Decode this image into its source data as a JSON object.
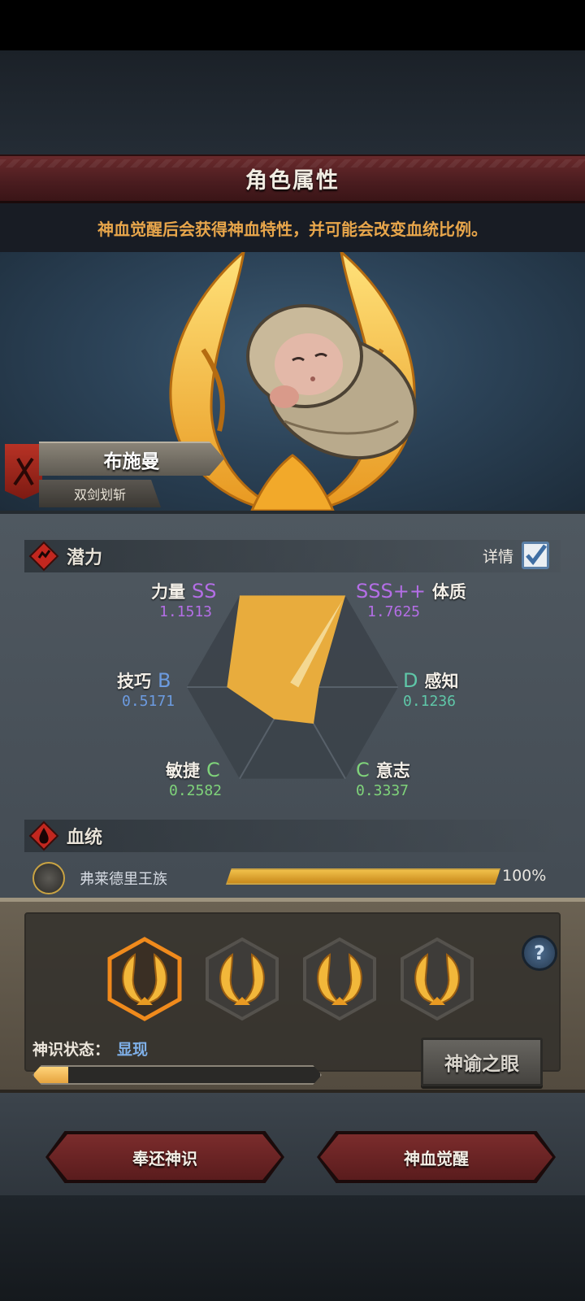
{
  "header": {
    "title": "角色属性",
    "subtitle": "神血觉醒后会获得神血特性，并可能会改变血统比例。"
  },
  "character": {
    "name": "布施曼",
    "class": "双剑划斩"
  },
  "potential": {
    "section_title": "潜力",
    "detail_label": "详情",
    "detail_checked": true,
    "stats": [
      {
        "name": "力量",
        "grade": "SS",
        "value": "1.1513",
        "color": "#b46ee6"
      },
      {
        "name": "体质",
        "grade": "SSS++",
        "value": "1.7625",
        "color": "#b46ee6"
      },
      {
        "name": "技巧",
        "grade": "B",
        "value": "0.5171",
        "color": "#6c9be0"
      },
      {
        "name": "感知",
        "grade": "D",
        "value": "0.1236",
        "color": "#5fc7a8"
      },
      {
        "name": "敏捷",
        "grade": "C",
        "value": "0.2582",
        "color": "#7fd37a"
      },
      {
        "name": "意志",
        "grade": "C",
        "value": "0.3337",
        "color": "#7fd37a"
      }
    ],
    "radar_levels": {
      "力量": 1.0,
      "体质": 1.0,
      "技巧": 0.62,
      "感知": 0.25,
      "敏捷": 0.35,
      "意志": 0.4
    }
  },
  "bloodline": {
    "section_title": "血统",
    "items": [
      {
        "name": "弗莱德里王族",
        "percent_text": "100%",
        "fraction": 1.0
      }
    ]
  },
  "awakening": {
    "selected_slot": 0,
    "slot_count": 4,
    "help_label": "?",
    "state_label": "神识状态：",
    "state_value": "显现",
    "progress_fraction": 0.12,
    "oracle_button": "神谕之眼"
  },
  "buttons": {
    "return": "奉还神识",
    "awaken": "神血觉醒"
  },
  "colors": {
    "gold": "#f4b73a",
    "banner_red": "#6a2a2c",
    "radar_fill": "#e8ac3d"
  }
}
